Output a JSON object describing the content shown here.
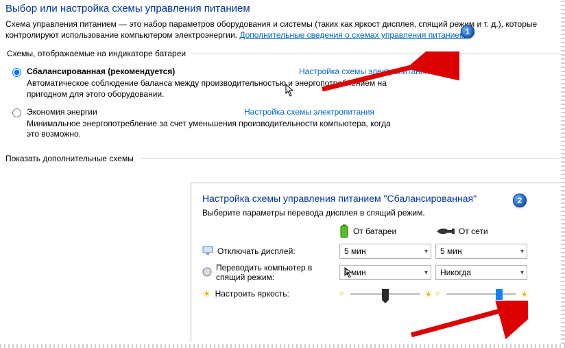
{
  "page_title": "Выбор или настройка схемы управления питанием",
  "description_pre": "Схема управления питанием — это набор параметров оборудования и системы (таких как яркост дисплея, спящий режим и т. д.), которые контролируют использование компьютером электроэнергии. ",
  "description_link": "Дополнительные сведения о схемах управления питанием",
  "group_legend": "Схемы, отображаемые на индикаторе батареи",
  "plans": [
    {
      "name": "Сбалансированная (рекомендуется)",
      "link": "Настройка схемы электропитания",
      "desc": "Автоматическое соблюдение баланса между производительностью и энергопотреблением на пригодном для этого оборудовании.",
      "checked": true
    },
    {
      "name": "Экономия энергии",
      "link": "Настройка схемы электропитания",
      "desc": "Минимальное энергопотребление за счет уменьшения производительности компьютера, когда это возможно.",
      "checked": false
    }
  ],
  "show_more": "Показать дополнительные схемы",
  "panel2": {
    "title": "Настройка схемы управления питанием \"Сбалансированная\"",
    "subtitle": "Выберите параметры перевода дисплея в спящий режим.",
    "col_battery": "От батареи",
    "col_ac": "От сети",
    "rows": {
      "display_off": {
        "label": "Отключать дисплей:",
        "battery": "5 мин",
        "ac": "5 мин"
      },
      "sleep": {
        "label": "Переводить компьютер в спящий режим:",
        "battery": "5 мин",
        "ac": "Никогда"
      },
      "brightness": {
        "label": "Настроить яркость:"
      }
    }
  },
  "badges": {
    "one": "1",
    "two": "2"
  }
}
